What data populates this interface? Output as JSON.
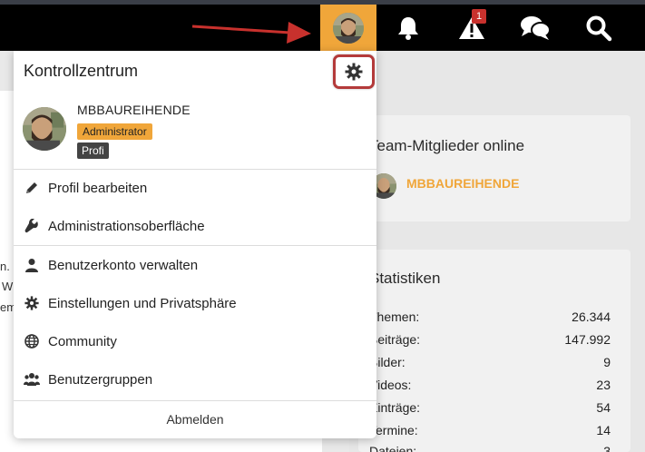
{
  "colors": {
    "accent": "#f0a63a",
    "highlight": "#b43a3a",
    "badge": "#c8312d",
    "bar": "#000000"
  },
  "header": {
    "notifications_badge": "1",
    "icons": [
      "bell-icon",
      "warning-icon",
      "chat-icon",
      "search-icon"
    ]
  },
  "dropdown": {
    "title": "Kontrollzentrum",
    "user": {
      "name": "MBBAUREIHENDE",
      "rank": "Administrator",
      "rank2": "Profi"
    },
    "items": [
      {
        "label": "Profil bearbeiten",
        "icon": "pencil-icon"
      },
      {
        "label": "Administrationsoberfläche",
        "icon": "wrench-icon"
      },
      {
        "label": "Benutzerkonto verwalten",
        "icon": "user-icon"
      },
      {
        "label": "Einstellungen und Privatsphäre",
        "icon": "gear-icon"
      },
      {
        "label": "Community",
        "icon": "globe-icon"
      },
      {
        "label": "Benutzergruppen",
        "icon": "users-icon"
      }
    ],
    "logout": "Abmelden"
  },
  "sidebar": {
    "online_title": "Team-Mitglieder online",
    "online_user": "MBBAUREIHENDE",
    "stats_title": "Statistiken",
    "stats": [
      {
        "label": "Themen:",
        "value": "26.344"
      },
      {
        "label": "Beiträge:",
        "value": "147.992"
      },
      {
        "label": "Bilder:",
        "value": "9"
      },
      {
        "label": "Videos:",
        "value": "23"
      },
      {
        "label": "Einträge:",
        "value": "54"
      },
      {
        "label": "Termine:",
        "value": "14"
      },
      {
        "label": "Dateien:",
        "value": "3"
      }
    ]
  },
  "left_fragments": [
    "n.",
    "W",
    "em"
  ]
}
